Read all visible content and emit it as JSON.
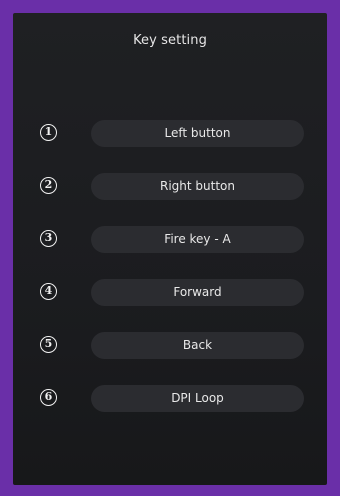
{
  "header": {
    "title": "Key setting"
  },
  "keys": [
    {
      "number": "1",
      "label": "Left button"
    },
    {
      "number": "2",
      "label": "Right button"
    },
    {
      "number": "3",
      "label": "Fire key - A"
    },
    {
      "number": "4",
      "label": "Forward"
    },
    {
      "number": "5",
      "label": "Back"
    },
    {
      "number": "6",
      "label": "DPI Loop"
    }
  ],
  "colors": {
    "border": "#6a2fa8",
    "panel": "#1d1e21",
    "button": "#2b2c30",
    "text": "#e8e8e8"
  }
}
